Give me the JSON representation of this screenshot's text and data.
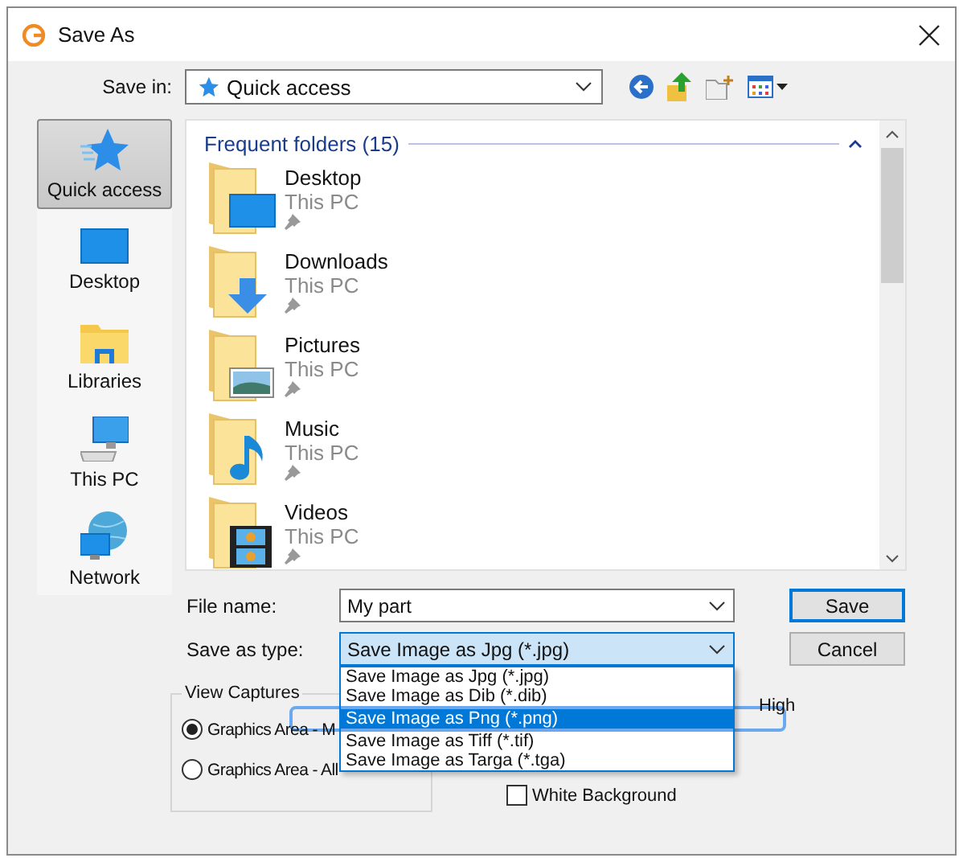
{
  "window": {
    "title": "Save As"
  },
  "save_in": {
    "label": "Save in:",
    "value": "Quick access"
  },
  "places": [
    {
      "label": "Quick access",
      "kind": "star",
      "selected": true
    },
    {
      "label": "Desktop",
      "kind": "desktop",
      "selected": false
    },
    {
      "label": "Libraries",
      "kind": "libraries",
      "selected": false
    },
    {
      "label": "This PC",
      "kind": "computer",
      "selected": false
    },
    {
      "label": "Network",
      "kind": "network",
      "selected": false
    }
  ],
  "file_list": {
    "group_title": "Frequent folders (15)",
    "items": [
      {
        "name": "Desktop",
        "location": "This PC",
        "kind": "desktop"
      },
      {
        "name": "Downloads",
        "location": "This PC",
        "kind": "downloads"
      },
      {
        "name": "Pictures",
        "location": "This PC",
        "kind": "pictures"
      },
      {
        "name": "Music",
        "location": "This PC",
        "kind": "music"
      },
      {
        "name": "Videos",
        "location": "This PC",
        "kind": "videos"
      }
    ]
  },
  "file_name": {
    "label": "File name:",
    "value": "My part"
  },
  "save_as_type": {
    "label": "Save as type:",
    "value": "Save Image as Jpg (*.jpg)",
    "options": [
      {
        "label": "Save Image as Jpg (*.jpg)",
        "highlighted": false
      },
      {
        "label": "Save Image as Dib (*.dib)",
        "highlighted": false
      },
      {
        "label": "Save Image as Png (*.png)",
        "highlighted": true
      },
      {
        "label": "Save Image as Tiff (*.tif)",
        "highlighted": false
      },
      {
        "label": "Save Image as Targa (*.tga)",
        "highlighted": false
      }
    ]
  },
  "buttons": [
    {
      "label": "Save",
      "default": true
    },
    {
      "label": "Cancel",
      "default": false
    }
  ],
  "view_captures": {
    "title": "View Captures",
    "options": [
      {
        "label": "Graphics Area - M",
        "selected": true
      },
      {
        "label": "Graphics Area - All",
        "selected": false
      }
    ]
  },
  "partial_label": "High",
  "white_background": {
    "label": "White Background",
    "checked": false
  }
}
